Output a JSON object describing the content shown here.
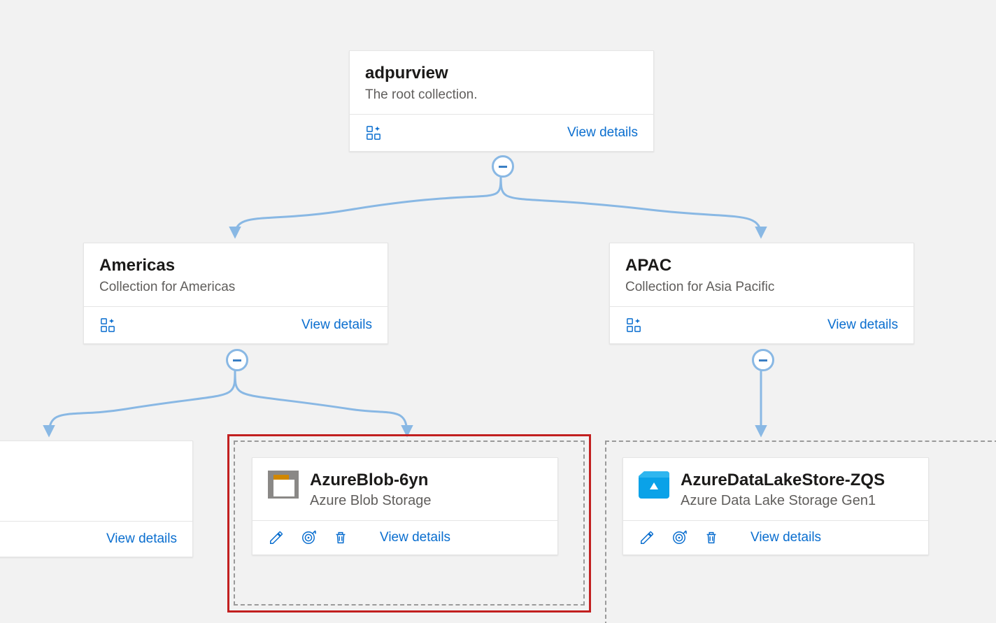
{
  "root": {
    "title": "adpurview",
    "subtitle": "The root collection.",
    "view_details": "View details"
  },
  "americas": {
    "title": "Americas",
    "subtitle": "Collection for Americas",
    "view_details": "View details"
  },
  "apac": {
    "title": "APAC",
    "subtitle": "Collection for Asia Pacific",
    "view_details": "View details"
  },
  "partial_card": {
    "view_details": "View details"
  },
  "blob_source": {
    "title": "AzureBlob-6yn",
    "subtitle": "Azure Blob Storage",
    "view_details": "View details"
  },
  "adls_source": {
    "title": "AzureDataLakeStore-ZQS",
    "subtitle": "Azure Data Lake Storage Gen1",
    "view_details": "View details"
  },
  "icons": {
    "grid": "grid-sparkle-icon",
    "edit": "edit-icon",
    "scan": "target-icon",
    "delete": "trash-icon",
    "collapse": "collapse-icon",
    "blob": "blob-storage-icon",
    "adls": "adls-icon"
  },
  "colors": {
    "link": "#0A6ECF",
    "connector": "#89b8e4",
    "highlight": "#c22020"
  }
}
